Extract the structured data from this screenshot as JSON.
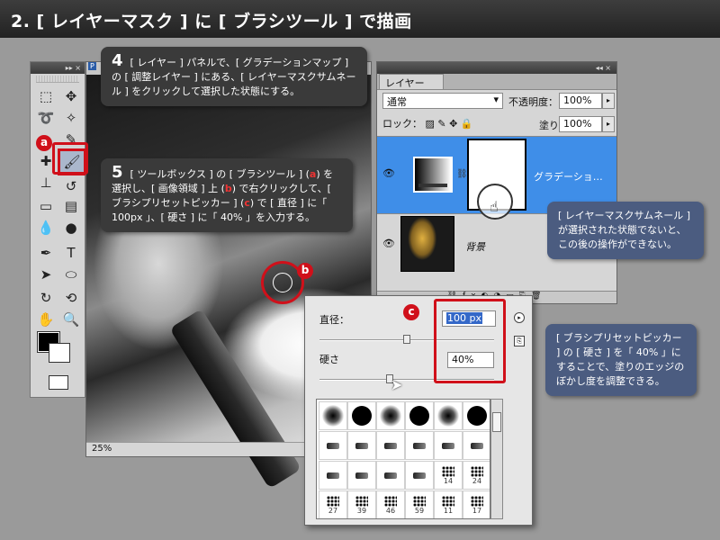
{
  "title": "2. [ レイヤーマスク ] に [ ブラシツール ] で描画",
  "tools_panel": {
    "header_arrows": "▸▸ ×",
    "tool_icons": [
      "marquee-icon",
      "move-icon",
      "lasso-icon",
      "magic-wand-icon",
      "crop-icon",
      "eyedropper-icon",
      "healing-icon",
      "brush-icon",
      "stamp-icon",
      "history-brush-icon",
      "eraser-icon",
      "gradient-icon",
      "blur-icon",
      "dodge-icon",
      "pen-icon",
      "type-icon",
      "path-select-icon",
      "shape-icon",
      "3d-rotate-icon",
      "3d-orbit-icon",
      "hand-icon",
      "zoom-icon"
    ]
  },
  "document": {
    "zoom": "25%",
    "tab_letter": "P"
  },
  "layers_panel": {
    "tab": "レイヤー",
    "blend_mode": "通常",
    "opacity_label": "不透明度：",
    "opacity": "100%",
    "lock_label": "ロック：",
    "fill_label": "塗り：",
    "fill": "100%",
    "layers": [
      {
        "name": "グラデーショ…",
        "active": true
      },
      {
        "name": "背景",
        "active": false
      }
    ]
  },
  "brush_picker": {
    "diameter_label": "直径：",
    "diameter": "100 px",
    "hardness_label": "硬さ",
    "hardness": "40%",
    "diameter_level": 0.5,
    "hardness_level": 0.4,
    "presets": [
      {
        "kind": "soft",
        "label": ""
      },
      {
        "kind": "hard",
        "label": ""
      },
      {
        "kind": "soft",
        "label": ""
      },
      {
        "kind": "hard",
        "label": ""
      },
      {
        "kind": "soft",
        "label": ""
      },
      {
        "kind": "hard",
        "label": ""
      },
      {
        "kind": "tip",
        "label": ""
      },
      {
        "kind": "tip",
        "label": ""
      },
      {
        "kind": "tip",
        "label": ""
      },
      {
        "kind": "tip",
        "label": ""
      },
      {
        "kind": "tip",
        "label": ""
      },
      {
        "kind": "tip",
        "label": ""
      },
      {
        "kind": "tip",
        "label": ""
      },
      {
        "kind": "tip",
        "label": ""
      },
      {
        "kind": "tip",
        "label": ""
      },
      {
        "kind": "tip",
        "label": ""
      },
      {
        "kind": "splat",
        "label": "14"
      },
      {
        "kind": "splat",
        "label": "24"
      },
      {
        "kind": "splat",
        "label": "27"
      },
      {
        "kind": "splat",
        "label": "39"
      },
      {
        "kind": "splat",
        "label": "46"
      },
      {
        "kind": "splat",
        "label": "59"
      },
      {
        "kind": "splat",
        "label": "11"
      },
      {
        "kind": "splat",
        "label": "17"
      }
    ]
  },
  "callouts": {
    "step4": {
      "num": "4",
      "text": "[ レイヤー ] パネルで、[ グラデーションマップ ] の [ 調整レイヤー ] にある、[ レイヤーマスクサムネール ] をクリックして選択した状態にする。"
    },
    "step5": {
      "num": "5",
      "text_a": "[ ツールボックス ] の [ ブラシツール ] (",
      "badge_a": "a",
      "text_b": ") を選択し、[ 画像領域 ] 上 (",
      "badge_b": "b",
      "text_c": ") で右クリックして、[ ブラシプリセットピッカー ] (",
      "badge_c": "c",
      "text_d": ") で [ 直径 ] に「 100px 」、[ 硬さ ] に「 40% 」を入力する。"
    },
    "note_mask": "[ レイヤーマスクサムネール ] が選択された状態でないと、この後の操作ができない。",
    "note_hardness": "[ ブラシプリセットピッカー ] の [ 硬さ ] を「 40% 」にすることで、塗りのエッジのぼかし度を調整できる。"
  },
  "badges": {
    "a": "a",
    "b": "b",
    "c": "c"
  }
}
